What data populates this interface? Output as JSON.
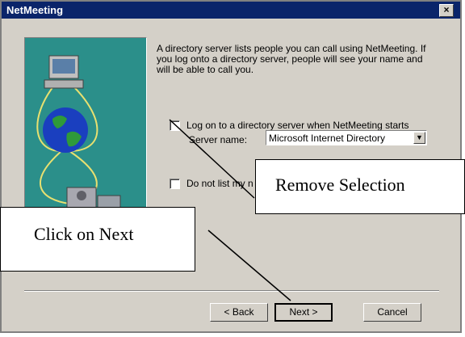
{
  "window": {
    "title": "NetMeeting",
    "close_glyph": "×"
  },
  "description": "A directory server lists people you can call using NetMeeting. If you log onto a directory server, people will see your name and will be able to call you.",
  "options": {
    "logon_label": "Log on to a directory server when NetMeeting starts",
    "server_label": "Server name:",
    "server_value": "Microsoft Internet Directory",
    "dont_list_label": "Do not list my n"
  },
  "buttons": {
    "back": "< Back",
    "next": "Next >",
    "cancel": "Cancel"
  },
  "annotations": {
    "remove_selection": "Remove Selection",
    "click_next": "Click on Next"
  }
}
